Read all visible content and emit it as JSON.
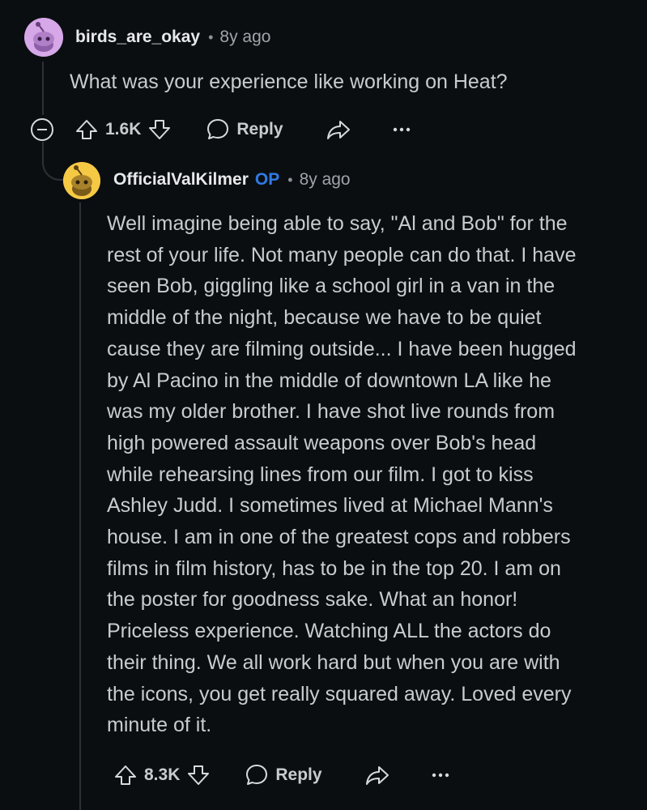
{
  "parent_comment": {
    "username": "birds_are_okay",
    "separator": "•",
    "age": "8y ago",
    "body": "What was your experience like working on Heat?",
    "upvote_count": "1.6K",
    "reply_label": "Reply",
    "avatar_icon": "snoo-avatar-lavender",
    "avatar_color": "#d6a8e8"
  },
  "reply_comment": {
    "username": "OfficialValKilmer",
    "op_badge": "OP",
    "separator": "•",
    "age": "8y ago",
    "body_lines": [
      "Well imagine being able to say, \"Al and Bob\" for the",
      "rest of your life. Not many people can do that. I have",
      "seen Bob, giggling like a school girl in a van in the",
      "middle of the night, because we have to be quiet",
      "cause they are filming outside... I have been hugged",
      "by Al Pacino in the middle of downtown LA like he",
      "was my older brother. I have shot live rounds from",
      "high powered assault weapons over Bob's head",
      "while rehearsing lines from our film. I got to kiss",
      "Ashley Judd. I sometimes lived at Michael Mann's",
      "house. I am in one of the greatest cops and robbers",
      "films in film history, has to be in the top 20. I am on",
      "the poster for goodness sake. What an honor!",
      "Priceless experience. Watching ALL the actors do",
      "their thing. We all work hard but when you are with",
      "the icons, you get really squared away. Loved every",
      "minute of it."
    ],
    "upvote_count": "8.3K",
    "reply_label": "Reply",
    "avatar_icon": "snoo-avatar-yellow",
    "avatar_color": "#f6c945"
  },
  "colors": {
    "background": "#0b0e11",
    "text": "#c8ccce",
    "op_badge": "#2f7be5",
    "thread_line": "#2a3236"
  }
}
